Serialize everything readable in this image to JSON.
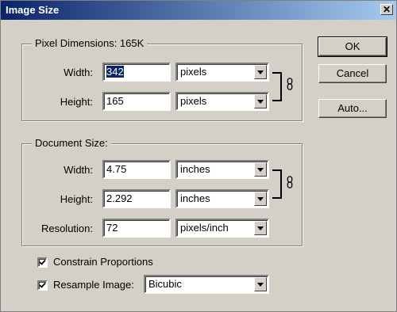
{
  "window": {
    "title": "Image Size",
    "close_glyph": "✕"
  },
  "pixel_dimensions": {
    "label": "Pixel Dimensions:  165K",
    "width_label": "Width:",
    "width_value": "342",
    "width_unit": "pixels",
    "height_label": "Height:",
    "height_value": "165",
    "height_unit": "pixels"
  },
  "document_size": {
    "label": "Document Size:",
    "width_label": "Width:",
    "width_value": "4.75",
    "width_unit": "inches",
    "height_label": "Height:",
    "height_value": "2.292",
    "height_unit": "inches",
    "resolution_label": "Resolution:",
    "resolution_value": "72",
    "resolution_unit": "pixels/inch"
  },
  "options": {
    "constrain_label": "Constrain Proportions",
    "constrain_checked": true,
    "resample_label": "Resample Image:",
    "resample_checked": true,
    "resample_method": "Bicubic"
  },
  "buttons": {
    "ok": "OK",
    "cancel": "Cancel",
    "auto": "Auto..."
  },
  "icons": {
    "link": "chain-link-icon",
    "dropdown": "chevron-down-icon",
    "check": "checkmark-icon"
  },
  "colors": {
    "titlebar_start": "#0a246a",
    "titlebar_end": "#a6caf0",
    "face": "#d4d0c8",
    "selection": "#0a246a"
  }
}
